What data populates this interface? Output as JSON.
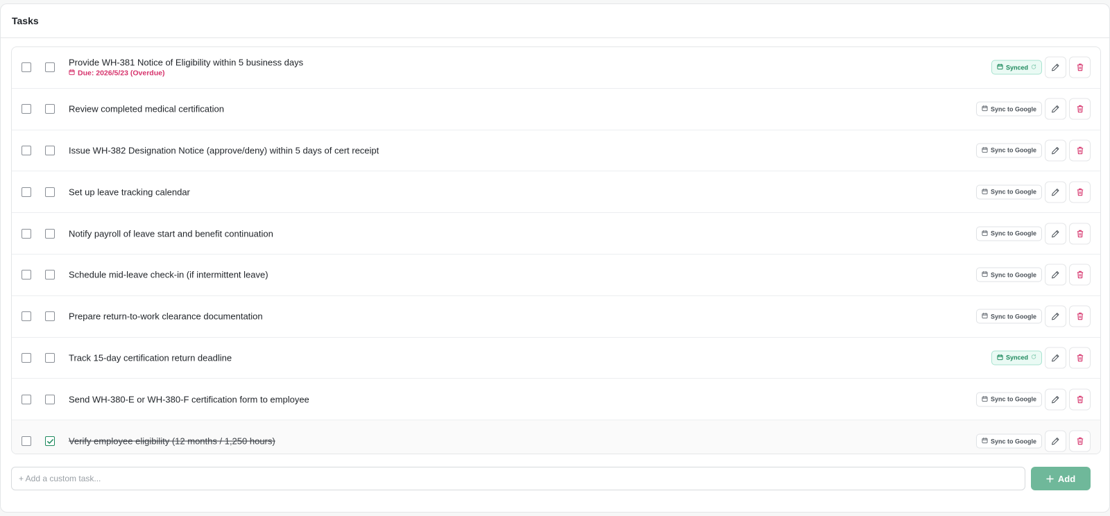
{
  "panel": {
    "title": "Tasks"
  },
  "tasks": [
    {
      "title": "Provide WH-381 Notice of Eligibility within 5 business days",
      "due": "Due: 2026/5/23 (Overdue)",
      "sync": "Synced",
      "synced": true,
      "done": false
    },
    {
      "title": "Review completed medical certification",
      "sync": "Sync to Google",
      "synced": false,
      "done": false
    },
    {
      "title": "Issue WH-382 Designation Notice (approve/deny) within 5 days of cert receipt",
      "sync": "Sync to Google",
      "synced": false,
      "done": false
    },
    {
      "title": "Set up leave tracking calendar",
      "sync": "Sync to Google",
      "synced": false,
      "done": false
    },
    {
      "title": "Notify payroll of leave start and benefit continuation",
      "sync": "Sync to Google",
      "synced": false,
      "done": false
    },
    {
      "title": "Schedule mid-leave check-in (if intermittent leave)",
      "sync": "Sync to Google",
      "synced": false,
      "done": false
    },
    {
      "title": "Prepare return-to-work clearance documentation",
      "sync": "Sync to Google",
      "synced": false,
      "done": false
    },
    {
      "title": "Track 15-day certification return deadline",
      "sync": "Synced",
      "synced": true,
      "done": false
    },
    {
      "title": "Send WH-380-E or WH-380-F certification form to employee",
      "sync": "Sync to Google",
      "synced": false,
      "done": false
    },
    {
      "title": "Verify employee eligibility (12 months / 1,250 hours)",
      "sync": "Sync to Google",
      "synced": false,
      "done": true
    }
  ],
  "add": {
    "placeholder": "+ Add a custom task...",
    "button_label": "Add"
  },
  "colors": {
    "accent": "#1f8a5e",
    "danger": "#d6336c",
    "add_button": "#6fb89a"
  },
  "icons": {
    "calendar": "calendar-icon",
    "refresh": "refresh-icon",
    "edit": "pencil-icon",
    "delete": "trash-icon",
    "plus": "plus-icon",
    "check": "check-icon"
  }
}
